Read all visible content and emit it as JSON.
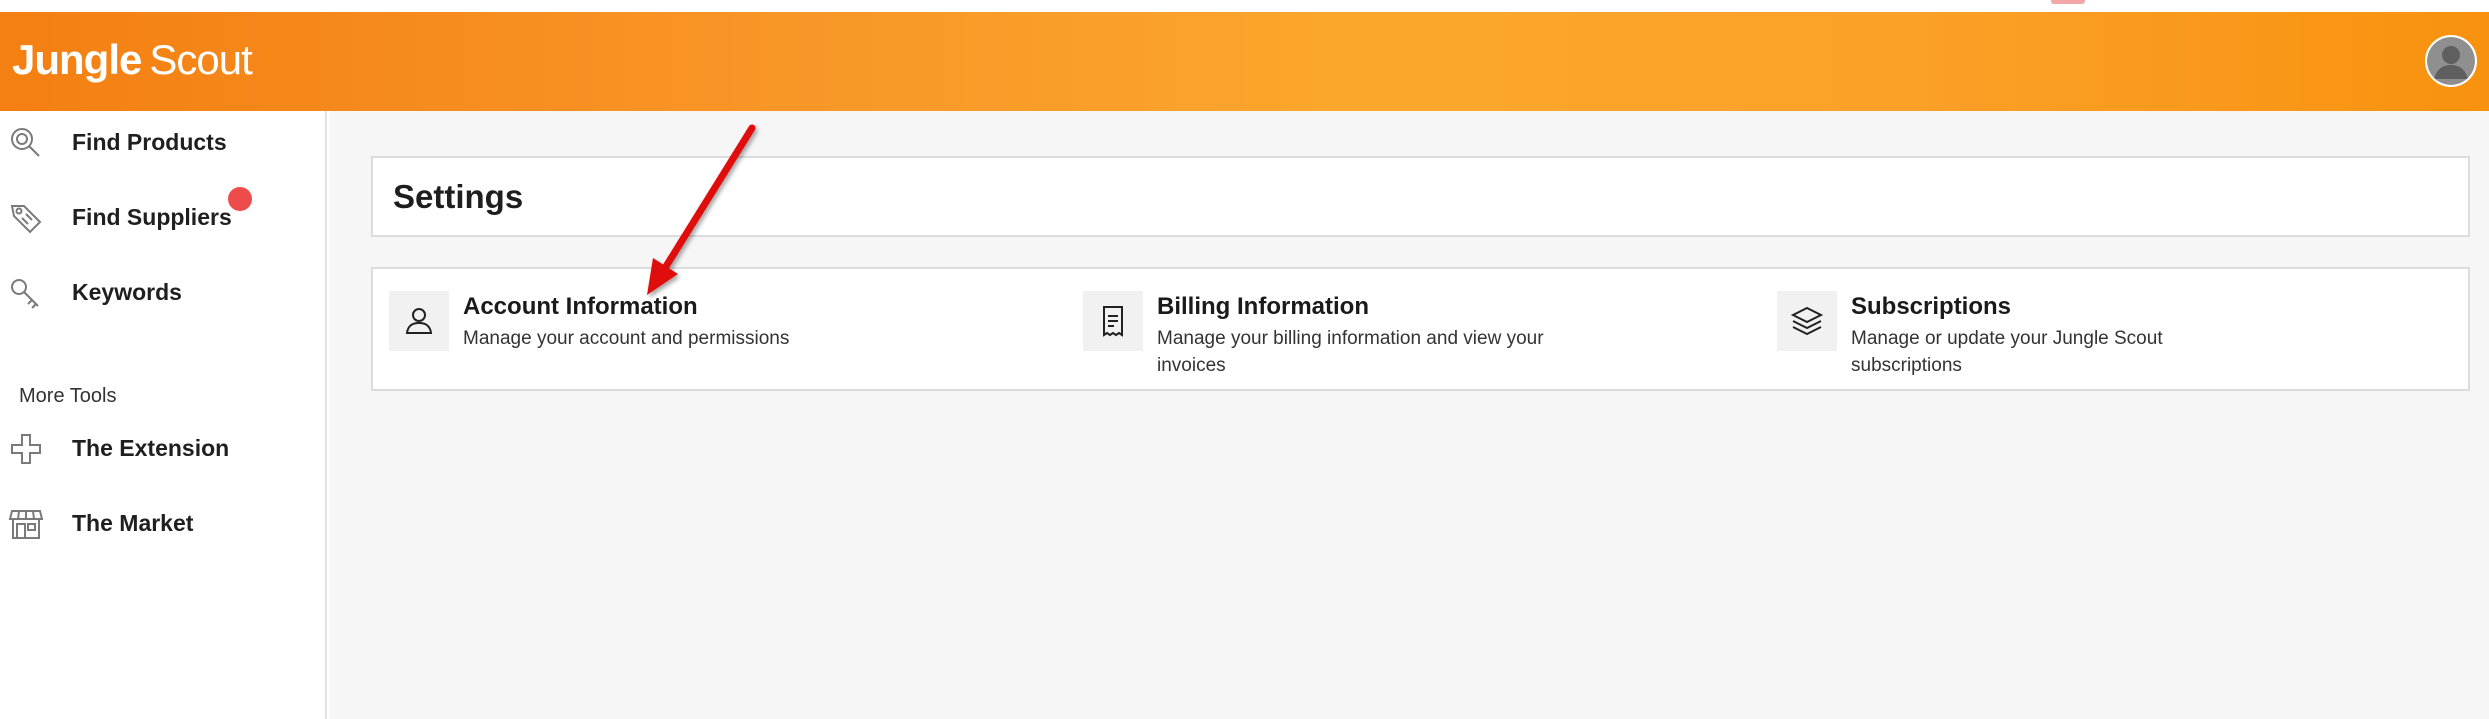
{
  "app": {
    "logo_word1": "Jungle",
    "logo_word2": "Scout",
    "brand_color": "#f7941d",
    "avatar_icon": "user-avatar-icon"
  },
  "sidebar": {
    "items": [
      {
        "label": "Find Products",
        "icon": "search-icon"
      },
      {
        "label": "Find Suppliers",
        "icon": "tag-icon"
      },
      {
        "label": "Keywords",
        "icon": "key-icon"
      }
    ],
    "section_label": "More Tools",
    "tools": [
      {
        "label": "The Extension",
        "icon": "puzzle-icon"
      },
      {
        "label": "The Market",
        "icon": "store-icon"
      }
    ],
    "badge_color": "#ee4b4b"
  },
  "main": {
    "title": "Settings",
    "options": [
      {
        "title": "Account Information",
        "description": "Manage your account and permissions",
        "icon": "user-icon"
      },
      {
        "title": "Billing Information",
        "description": "Manage your billing information and view your invoices",
        "icon": "receipt-icon"
      },
      {
        "title": "Subscriptions",
        "description": "Manage or update your Jungle Scout subscriptions",
        "icon": "layers-icon"
      }
    ]
  },
  "annotation": {
    "color": "#e01010",
    "icon": "red-arrow-annotation"
  }
}
